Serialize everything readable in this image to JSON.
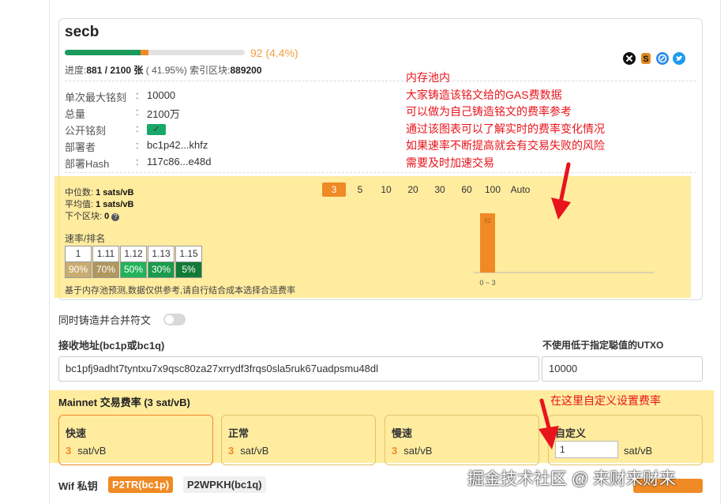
{
  "token": {
    "name": "secb",
    "pending": "92 (4.4%)",
    "progress": {
      "label": "进度:",
      "value": "881 / 2100 张",
      "percent": "( 41.95%)",
      "index_label": "索引区块:",
      "index_value": "889200",
      "minted_fraction": 0.4195,
      "pending_fraction": 0.044
    },
    "icons": [
      "cross-icon",
      "dollar-icon",
      "chain-icon",
      "twitter-icon"
    ],
    "icon_colors": [
      "#111111",
      "#e08a1e",
      "#2d8ce8",
      "#1d9bf0"
    ],
    "info": [
      {
        "key": "单次最大铭刻",
        "value": "10000"
      },
      {
        "key": "总量",
        "value": "2100万"
      },
      {
        "key": "公开铭刻",
        "value": "✓"
      },
      {
        "key": "部署者",
        "value": "bc1p42...khfz"
      },
      {
        "key": "部署Hash",
        "value": "117c86...e48d"
      }
    ],
    "colon": ":"
  },
  "annotation_top": [
    "内存池内",
    "大家铸造该铭文给的GAS费数据",
    "可以做为自己铸造铭文的费率参考",
    "通过该图表可以了解实时的费率变化情况",
    "如果速率不断提高就会有交易失败的风险",
    "需要及时加速交易"
  ],
  "annotation_fee": "在这里自定义设置费率",
  "mempool": {
    "median_label": "中位数:",
    "median_value": "1 sats/vB",
    "avg_label": "平均值:",
    "avg_value": "1 sats/vB",
    "next_label": "下个区块:",
    "next_value": "0",
    "help_glyph": "?",
    "rank_label": "速率/排名",
    "rates": [
      "1",
      "1.11",
      "1.12",
      "1.13",
      "1.15"
    ],
    "ranks": [
      "90%",
      "70%",
      "50%",
      "30%",
      "5%"
    ],
    "rank_colors": [
      "#c9ac70",
      "#b0975e",
      "#22b35a",
      "#1a9b4c",
      "#127a36"
    ],
    "note": "基于内存池预测,数据仅供参考,请自行结合成本选择合适费率",
    "block_options": [
      "3",
      "5",
      "10",
      "20",
      "30",
      "60",
      "100",
      "Auto"
    ],
    "selected_block": "3"
  },
  "chart_data": {
    "type": "bar",
    "categories": [
      "0 ~ 3"
    ],
    "values": [
      92
    ],
    "data_labels": [
      "92"
    ],
    "color": "#f08a24"
  },
  "merge_toggle": "同时铸造并合并符文",
  "receive": {
    "label": "接收地址(bc1p或bc1q)",
    "value": "bc1pfj9adht7tyntxu7x9qsc80za27xrrydf3frqs0sla5ruk67uadpsmu48dl"
  },
  "utxo": {
    "label": "不使用低于指定聪值的UTXO",
    "value": "10000"
  },
  "fee": {
    "title": "Mainnet 交易费率 (3 sat/vB)",
    "options": [
      {
        "label": "快速",
        "value": "3",
        "unit": "sat/vB"
      },
      {
        "label": "正常",
        "value": "3",
        "unit": "sat/vB"
      },
      {
        "label": "慢速",
        "value": "3",
        "unit": "sat/vB"
      }
    ],
    "custom_label": "自定义",
    "custom_value": "1",
    "custom_unit": "sat/vB"
  },
  "wif": {
    "label": "Wif 私钥",
    "tab_p2tr": "P2TR(bc1p)",
    "tab_p2wpkh": "P2WPKH(bc1q)"
  },
  "watermark": "掘金技术社区 @ 来财来财来",
  "colors": {
    "accent": "#f08a24",
    "green": "#1a9b5c",
    "annotation": "#e8141b",
    "highlight": "#ffdc50"
  }
}
